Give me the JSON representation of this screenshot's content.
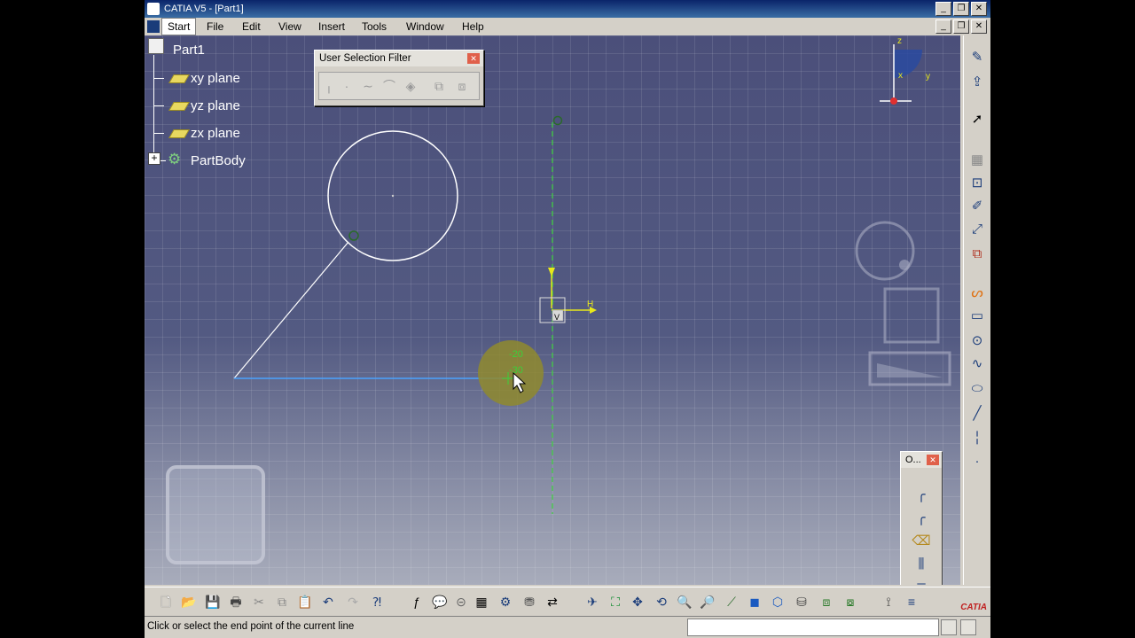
{
  "window": {
    "title": "CATIA V5 - [Part1]",
    "buttons": {
      "minimize": "_",
      "restore": "❐",
      "close": "✕"
    }
  },
  "menu": {
    "items": [
      {
        "label": "Start"
      },
      {
        "label": "File"
      },
      {
        "label": "Edit"
      },
      {
        "label": "View"
      },
      {
        "label": "Insert"
      },
      {
        "label": "Tools"
      },
      {
        "label": "Window"
      },
      {
        "label": "Help"
      }
    ]
  },
  "tree": {
    "root": "Part1",
    "items": [
      {
        "label": "xy plane"
      },
      {
        "label": "yz plane"
      },
      {
        "label": "zx plane"
      },
      {
        "label": "PartBody"
      }
    ],
    "expander": "+"
  },
  "selection_filter": {
    "title": "User Selection Filter",
    "close": "✕"
  },
  "sketch": {
    "h_label": "H",
    "v_label": "V",
    "readout_1": "-20",
    "readout_2": "-30"
  },
  "compass": {
    "z_label": "z",
    "x_label": "x",
    "y_label": "y"
  },
  "palette": {
    "title": "O...",
    "close": "✕"
  },
  "status": {
    "text": "Click or select the end point of the current line"
  },
  "brand": "CATIA",
  "colors": {
    "titlebar": "#0a246a",
    "canvas": "#51567e",
    "construction_green": "#3ad13a",
    "axis_yellow": "#e8e81a",
    "rubber_band_line": "#4aa3ff",
    "cursor_highlight": "#8f8a2e"
  }
}
